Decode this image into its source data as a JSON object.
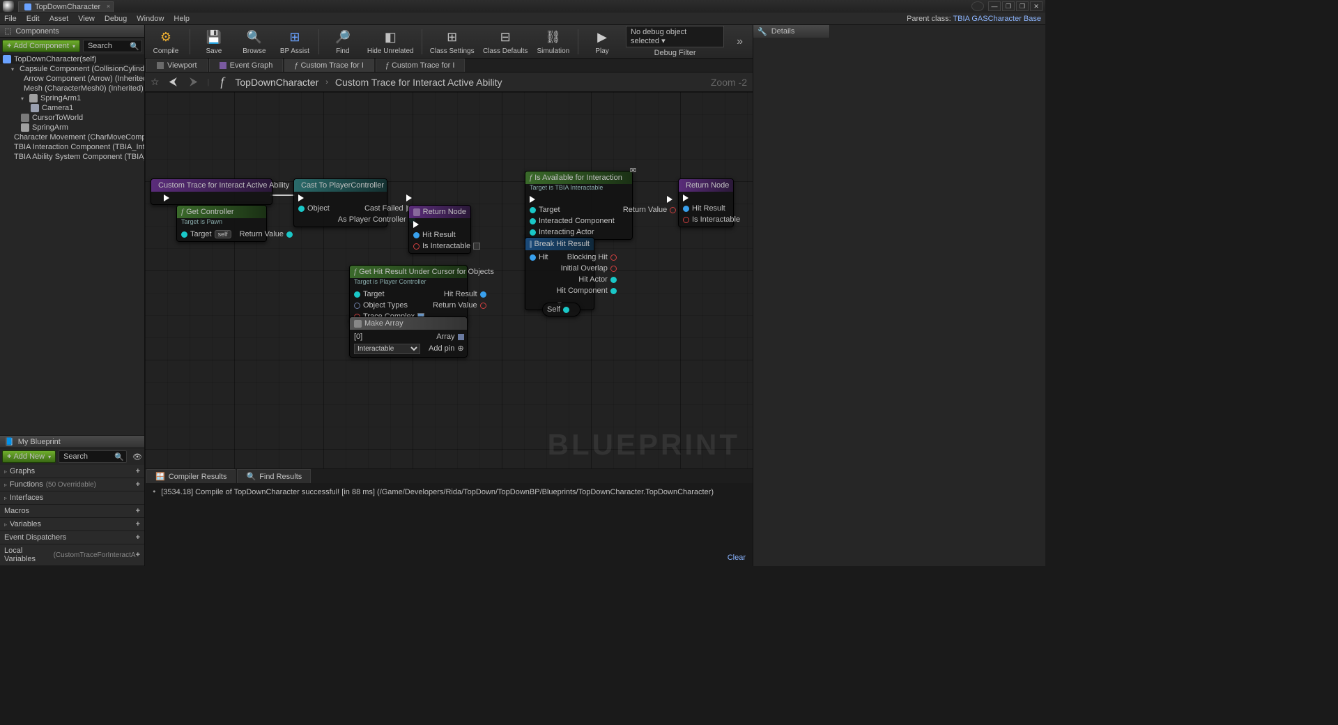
{
  "title_tab": "TopDownCharacter",
  "menus": [
    "File",
    "Edit",
    "Asset",
    "View",
    "Debug",
    "Window",
    "Help"
  ],
  "parent_class_label": "Parent class:",
  "parent_class": "TBIA GASCharacter Base",
  "components": {
    "panel": "Components",
    "add_btn": "Add Component",
    "search_ph": "Search",
    "root": "TopDownCharacter(self)",
    "items": [
      "Capsule Component (CollisionCylinder) (",
      "Arrow Component (Arrow) (Inherited)",
      "Mesh (CharacterMesh0) (Inherited)",
      "SpringArm1",
      "Camera1",
      "CursorToWorld",
      "SpringArm",
      "Character Movement (CharMoveComp) (I",
      "TBIA Interaction Component (TBIA_Intera",
      "TBIA Ability System Component (TBIA_Al"
    ]
  },
  "mybp": {
    "panel": "My Blueprint",
    "add_btn": "Add New",
    "search_ph": "Search",
    "cats": {
      "graphs": "Graphs",
      "functions": "Functions",
      "functions_sub": "(50 Overridable)",
      "interfaces": "Interfaces",
      "macros": "Macros",
      "variables": "Variables",
      "events": "Event Dispatchers",
      "locals": "Local Variables",
      "locals_sub": "(CustomTraceForInteractA"
    }
  },
  "toolbar": {
    "compile": "Compile",
    "save": "Save",
    "browse": "Browse",
    "bpassist": "BP Assist",
    "find": "Find",
    "hide": "Hide Unrelated",
    "classset": "Class Settings",
    "classdef": "Class Defaults",
    "sim": "Simulation",
    "play": "Play",
    "debug_sel": "No debug object selected",
    "debug_filter": "Debug Filter"
  },
  "graph_tabs": [
    "Viewport",
    "Event Graph",
    "Custom Trace for I",
    "Custom Trace for I"
  ],
  "breadcrumb": {
    "class": "TopDownCharacter",
    "func": "Custom Trace for Interact Active Ability",
    "zoom": "Zoom -2"
  },
  "nodes": {
    "entry": "Custom Trace for Interact Active Ability",
    "getcontroller": {
      "title": "Get Controller",
      "sub": "Target is Pawn",
      "target": "Target",
      "self": "self",
      "rv": "Return Value"
    },
    "cast": {
      "title": "Cast To PlayerController",
      "obj": "Object",
      "fail": "Cast Failed",
      "aspc": "As Player Controller"
    },
    "ret1": {
      "title": "Return Node",
      "hit": "Hit Result",
      "inter": "Is Interactable"
    },
    "gethit": {
      "title": "Get Hit Result Under Cursor for Objects",
      "sub": "Target is Player Controller",
      "target": "Target",
      "objtypes": "Object Types",
      "trace": "Trace Complex",
      "hit": "Hit Result",
      "rv": "Return Value"
    },
    "makearr": {
      "title": "Make Array",
      "idx": "[0]",
      "val": "Interactable",
      "arr": "Array",
      "addpin": "Add pin"
    },
    "isavail": {
      "title": "Is Available for Interaction",
      "sub": "Target is TBIA Interactable",
      "target": "Target",
      "intcomp": "Interacted Component",
      "intact": "Interacting Actor",
      "rv": "Return Value"
    },
    "breakhit": {
      "title": "Break Hit Result",
      "hit": "Hit",
      "bhit": "Blocking Hit",
      "iover": "Initial Overlap",
      "hactor": "Hit Actor",
      "hcomp": "Hit Component"
    },
    "selfn": "Self",
    "ret2": {
      "title": "Return Node",
      "hit": "Hit Result",
      "inter": "Is Interactable"
    }
  },
  "watermark": "BLUEPRINT",
  "compiler": {
    "tab1": "Compiler Results",
    "tab2": "Find Results",
    "log": "[3534.18] Compile of TopDownCharacter successful! [in 88 ms] (/Game/Developers/Rida/TopDown/TopDownBP/Blueprints/TopDownCharacter.TopDownCharacter)",
    "clear": "Clear"
  },
  "details": {
    "panel": "Details"
  }
}
